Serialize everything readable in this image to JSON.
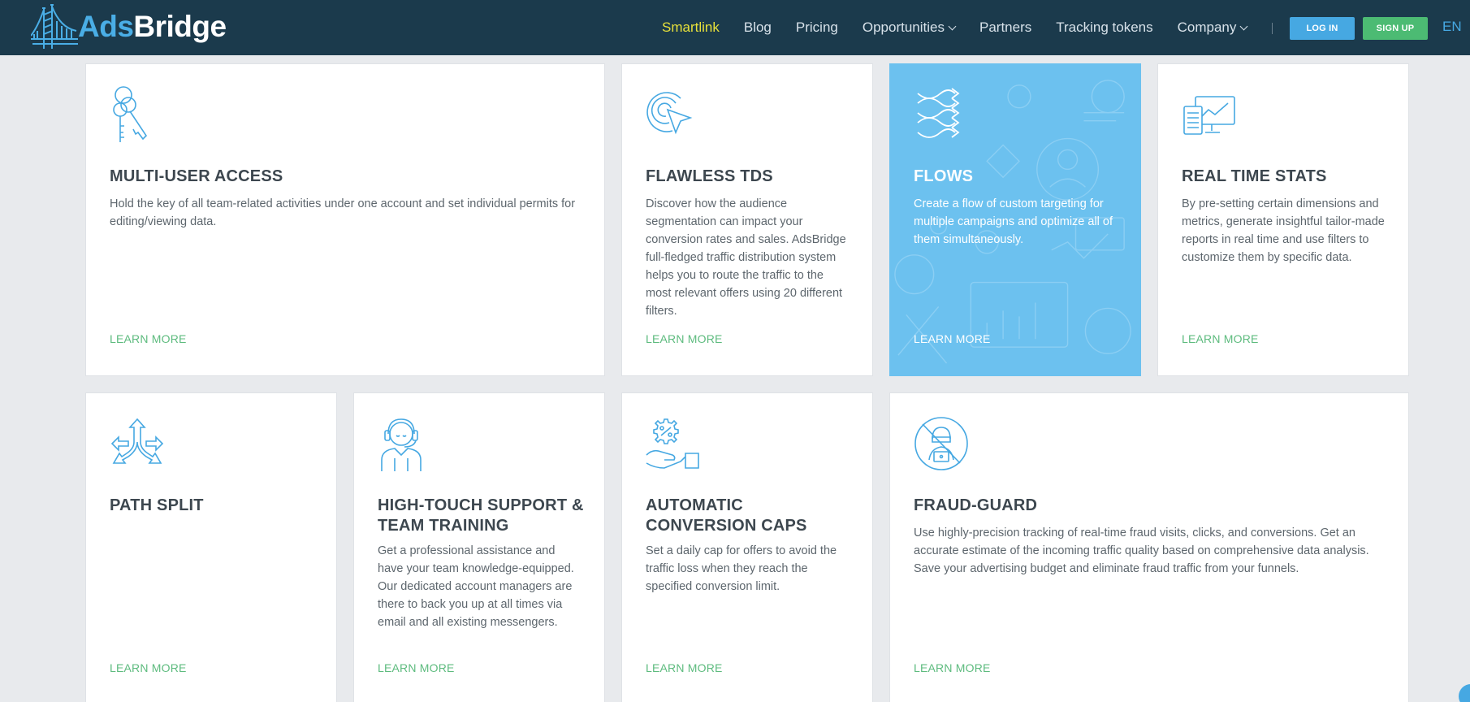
{
  "header": {
    "logo_ads": "Ads",
    "logo_bridge": "Bridge",
    "nav": [
      {
        "label": "Smartlink",
        "active": true,
        "dropdown": false
      },
      {
        "label": "Blog",
        "active": false,
        "dropdown": false
      },
      {
        "label": "Pricing",
        "active": false,
        "dropdown": false
      },
      {
        "label": "Opportunities",
        "active": false,
        "dropdown": true
      },
      {
        "label": "Partners",
        "active": false,
        "dropdown": false
      },
      {
        "label": "Tracking tokens",
        "active": false,
        "dropdown": false
      },
      {
        "label": "Company",
        "active": false,
        "dropdown": true
      }
    ],
    "login_label": "LOG IN",
    "signup_label": "SIGN UP",
    "language": "EN"
  },
  "colors": {
    "header_bg": "#1b3a4c",
    "accent_blue": "#46a8e2",
    "accent_green": "#4cbb73",
    "nav_active": "#e8e13a",
    "highlight_card": "#6cc1ef"
  },
  "cards": [
    {
      "icon": "keys-icon",
      "title": "MULTI-USER ACCESS",
      "description": "Hold the key of all team-related activities under one account and set individual permits for editing/viewing data.",
      "learn_more": "LEARN MORE"
    },
    {
      "icon": "target-cursor-icon",
      "title": "FLAWLESS TDS",
      "description": "Discover how the audience segmentation can impact your conversion rates and sales. AdsBridge full-fledged traffic distribution system helps you to route the traffic to the most relevant offers using 20 different filters.",
      "learn_more": "LEARN MORE"
    },
    {
      "icon": "flows-arrows-icon",
      "title": "FLOWS",
      "description": "Create a flow of custom targeting for multiple campaigns and optimize all of them simultaneously.",
      "learn_more": "LEARN MORE"
    },
    {
      "icon": "stats-monitor-icon",
      "title": "REAL TIME STATS",
      "description": "By pre-setting certain dimensions and metrics, generate insightful tailor-made reports in real time and use filters to customize them by specific data.",
      "learn_more": "LEARN MORE"
    },
    {
      "icon": "path-split-arrows-icon",
      "title": "PATH SPLIT",
      "description": "",
      "learn_more": "LEARN MORE"
    },
    {
      "icon": "support-agent-headset-icon",
      "title": "HIGH-TOUCH SUPPORT & TEAM TRAINING",
      "description": "Get a professional assistance and have your team knowledge-equipped. Our dedicated account managers are there to back you up at all times via email and all existing messengers.",
      "learn_more": "LEARN MORE"
    },
    {
      "icon": "gear-percent-hand-icon",
      "title": "AUTOMATIC CONVERSION CAPS",
      "description": "Set a daily cap for offers to avoid the traffic loss when they reach the specified conversion limit.",
      "learn_more": "LEARN MORE"
    },
    {
      "icon": "fraud-hacker-icon",
      "title": "FRAUD-GUARD",
      "description": "Use highly-precision tracking of real-time fraud visits, clicks, and conversions. Get an accurate estimate of the incoming traffic quality based on comprehensive data analysis. Save your advertising budget and eliminate fraud traffic from your funnels.",
      "learn_more": "LEARN MORE"
    }
  ]
}
